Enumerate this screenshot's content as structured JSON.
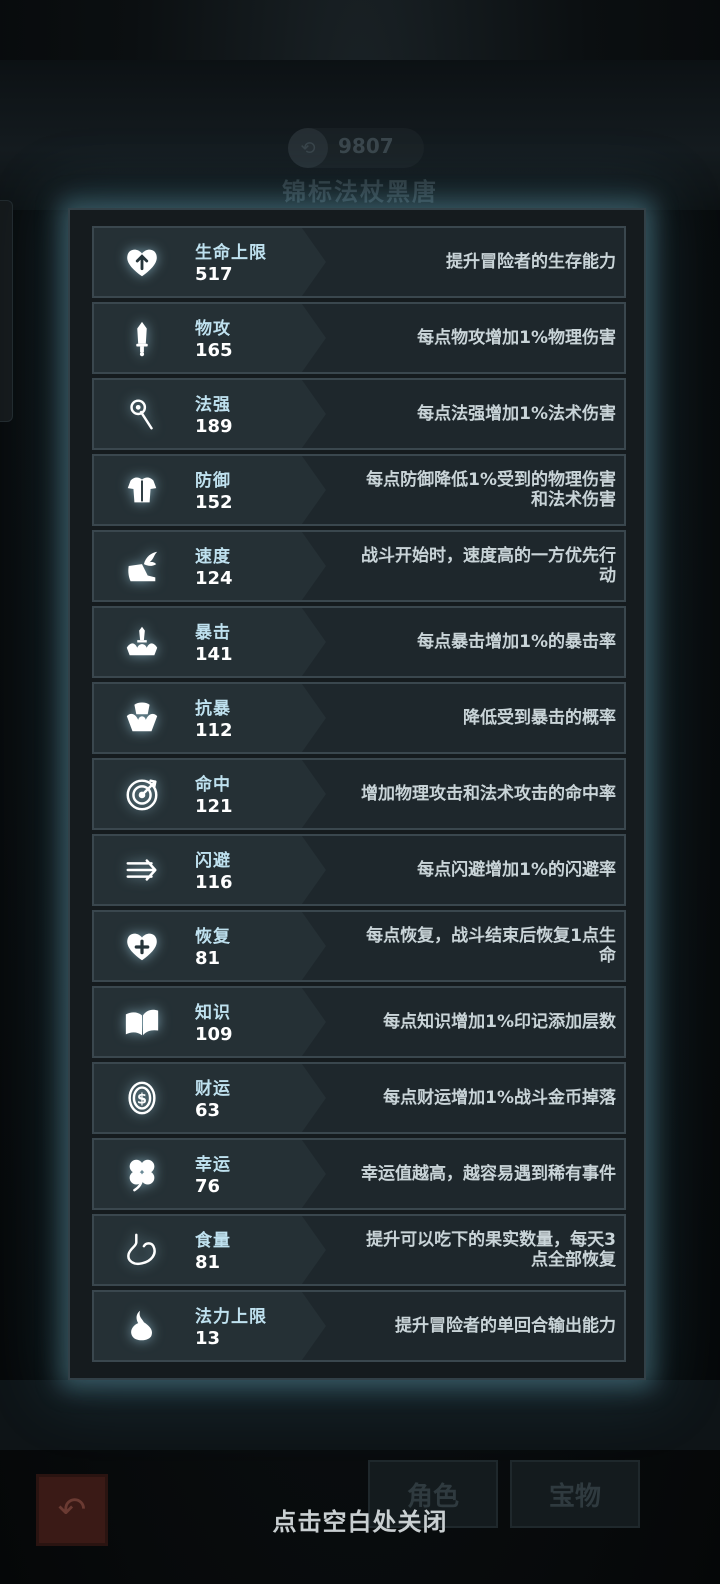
{
  "background": {
    "coin_icon": "coin-icon",
    "coin_value": "9807",
    "title": "锦标法杖黑唐",
    "back_icon": "back-arrow-icon",
    "tabs": [
      "角色",
      "宝物"
    ]
  },
  "stats": [
    {
      "icon": "heart-arrow-icon",
      "name": "生命上限",
      "value": "517",
      "desc": "提升冒险者的生存能力"
    },
    {
      "icon": "sword-icon",
      "name": "物攻",
      "value": "165",
      "desc": "每点物攻增加1%物理伤害"
    },
    {
      "icon": "staff-icon",
      "name": "法强",
      "value": "189",
      "desc": "每点法强增加1%法术伤害"
    },
    {
      "icon": "armor-icon",
      "name": "防御",
      "value": "152",
      "desc": "每点防御降低1%受到的物理伤害\n和法术伤害"
    },
    {
      "icon": "winged-boot-icon",
      "name": "速度",
      "value": "124",
      "desc": "战斗开始时，速度高的一方优先行\n动"
    },
    {
      "icon": "crit-icon",
      "name": "暴击",
      "value": "141",
      "desc": "每点暴击增加1%的暴击率"
    },
    {
      "icon": "crit-resist-icon",
      "name": "抗暴",
      "value": "112",
      "desc": "降低受到暴击的概率"
    },
    {
      "icon": "target-icon",
      "name": "命中",
      "value": "121",
      "desc": "增加物理攻击和法术攻击的命中率"
    },
    {
      "icon": "dodge-arrows-icon",
      "name": "闪避",
      "value": "116",
      "desc": "每点闪避增加1%的闪避率"
    },
    {
      "icon": "heart-plus-icon",
      "name": "恢复",
      "value": "81",
      "desc": "每点恢复，战斗结束后恢复1点生\n命"
    },
    {
      "icon": "book-icon",
      "name": "知识",
      "value": "109",
      "desc": "每点知识增加1%印记添加层数"
    },
    {
      "icon": "dollar-coin-icon",
      "name": "财运",
      "value": "63",
      "desc": "每点财运增加1%战斗金币掉落"
    },
    {
      "icon": "clover-icon",
      "name": "幸运",
      "value": "76",
      "desc": "幸运值越高，越容易遇到稀有事件"
    },
    {
      "icon": "stomach-icon",
      "name": "食量",
      "value": "81",
      "desc": "提升可以吃下的果实数量，每天3\n点全部恢复"
    },
    {
      "icon": "mana-drop-icon",
      "name": "法力上限",
      "value": "13",
      "desc": "提升冒险者的单回合输出能力"
    }
  ],
  "close_hint": "点击空白处关闭"
}
